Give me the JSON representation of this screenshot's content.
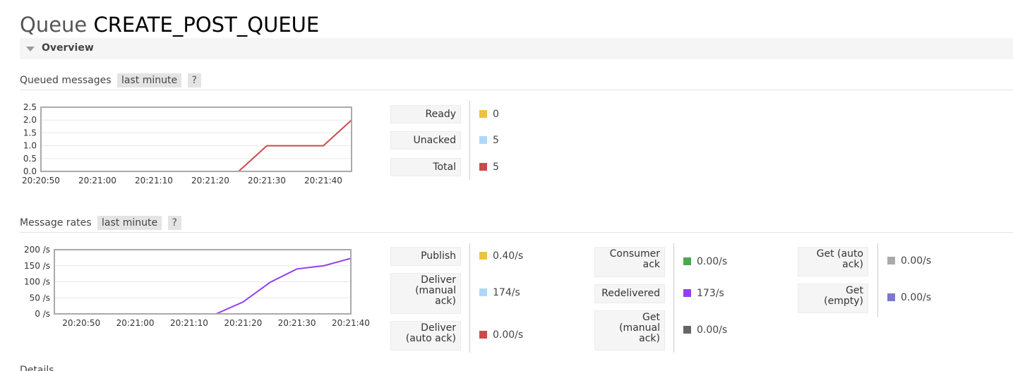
{
  "page": {
    "title_prefix": "Queue",
    "queue_name": "CREATE_POST_QUEUE",
    "section_label": "Overview",
    "details_label": "Details"
  },
  "queued": {
    "heading": "Queued messages",
    "range": "last minute",
    "help": "?",
    "stats": [
      {
        "label": "Ready",
        "value": "0",
        "color": "#edc240"
      },
      {
        "label": "Unacked",
        "value": "5",
        "color": "#afd8f8"
      },
      {
        "label": "Total",
        "value": "5",
        "color": "#cb4b4b"
      }
    ]
  },
  "rates": {
    "heading": "Message rates",
    "range": "last minute",
    "help": "?",
    "col1": [
      {
        "label": "Publish",
        "value": "0.40/s",
        "color": "#edc240"
      },
      {
        "label": "Deliver (manual ack)",
        "lines": [
          "Deliver",
          "(manual",
          "ack)"
        ],
        "value": "174/s",
        "color": "#afd8f8"
      },
      {
        "label": "Deliver (auto ack)",
        "lines": [
          "Deliver",
          "(auto ack)"
        ],
        "value": "0.00/s",
        "color": "#cb4b4b"
      }
    ],
    "col2": [
      {
        "label": "Consumer ack",
        "lines": [
          "Consumer",
          "ack"
        ],
        "value": "0.00/s",
        "color": "#4da74d"
      },
      {
        "label": "Redelivered",
        "value": "173/s",
        "color": "#9440ed"
      },
      {
        "label": "Get (manual ack)",
        "lines": [
          "Get",
          "(manual",
          "ack)"
        ],
        "value": "0.00/s",
        "color": "#666666"
      }
    ],
    "col3": [
      {
        "label": "Get (auto ack)",
        "lines": [
          "Get (auto",
          "ack)"
        ],
        "value": "0.00/s",
        "color": "#aaaaaa"
      },
      {
        "label": "Get (empty)",
        "lines": [
          "Get",
          "(empty)"
        ],
        "value": "0.00/s",
        "color": "#7c79c9"
      }
    ]
  },
  "chart_data": [
    {
      "type": "line",
      "x": [
        "20:20:50",
        "20:20:55",
        "20:21:00",
        "20:21:05",
        "20:21:10",
        "20:21:15",
        "20:21:20",
        "20:21:25",
        "20:21:30",
        "20:21:35",
        "20:21:40",
        "20:21:45"
      ],
      "xticks": [
        "20:20:50",
        "20:21:00",
        "20:21:10",
        "20:21:20",
        "20:21:30",
        "20:21:40"
      ],
      "yticks": [
        "0.0",
        "0.5",
        "1.0",
        "1.5",
        "2.0",
        "2.5"
      ],
      "ylim": [
        0,
        2.5
      ],
      "series": [
        {
          "name": "Ready",
          "color": "#edc240",
          "values": [
            0,
            0,
            0,
            0,
            0,
            0,
            0,
            0,
            0,
            0,
            0,
            0
          ]
        },
        {
          "name": "Total",
          "color": "#cb4b4b",
          "values": [
            0,
            0,
            0,
            0,
            0,
            0,
            0,
            0,
            1,
            1,
            1,
            2
          ]
        }
      ]
    },
    {
      "type": "line",
      "x": [
        "20:20:45",
        "20:20:50",
        "20:20:55",
        "20:21:00",
        "20:21:05",
        "20:21:10",
        "20:21:15",
        "20:21:20",
        "20:21:25",
        "20:21:30",
        "20:21:35",
        "20:21:40"
      ],
      "xticks": [
        "20:20:50",
        "20:21:00",
        "20:21:10",
        "20:21:20",
        "20:21:30",
        "20:21:40"
      ],
      "yticks": [
        "0 /s",
        "50 /s",
        "100 /s",
        "150 /s",
        "200 /s"
      ],
      "ylim": [
        0,
        200
      ],
      "series": [
        {
          "name": "Deliver (manual ack)",
          "color": "#afd8f8",
          "values": [
            0,
            0,
            0,
            0,
            0,
            0,
            0,
            0,
            0,
            0,
            0,
            0
          ]
        },
        {
          "name": "Redelivered",
          "color": "#9440ed",
          "values": [
            0,
            0,
            0,
            0,
            0,
            0,
            0,
            37,
            98,
            140,
            150,
            173
          ]
        }
      ]
    }
  ]
}
